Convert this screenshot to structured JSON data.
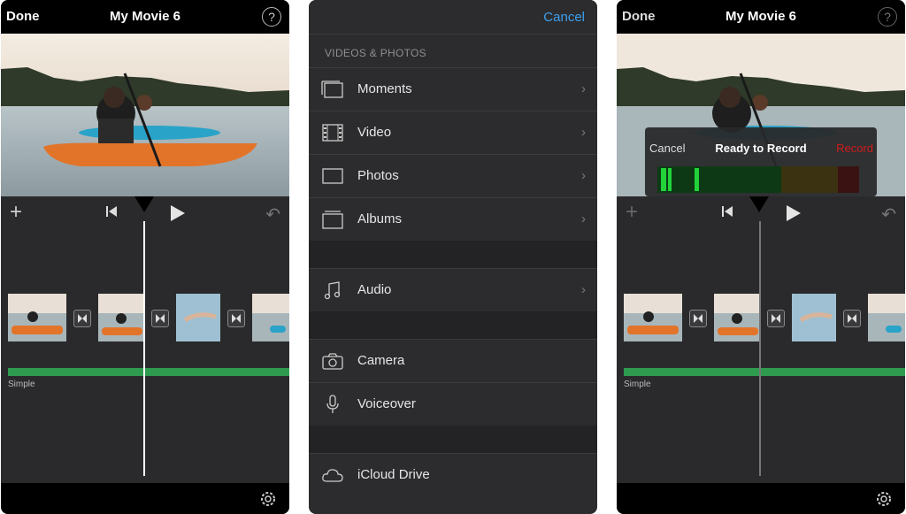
{
  "editor": {
    "done_label": "Done",
    "title": "My Movie 6",
    "help_icon": "?",
    "music_label": "Simple"
  },
  "picker": {
    "cancel_label": "Cancel",
    "section_header": "VIDEOS & PHOTOS",
    "items": [
      {
        "label": "Moments",
        "icon": "moments-icon",
        "chevron": "›"
      },
      {
        "label": "Video",
        "icon": "film-icon",
        "chevron": "›"
      },
      {
        "label": "Photos",
        "icon": "photo-icon",
        "chevron": "›"
      },
      {
        "label": "Albums",
        "icon": "albums-icon",
        "chevron": "›"
      },
      {
        "label": "Audio",
        "icon": "music-note-icon",
        "chevron": "›"
      },
      {
        "label": "Camera",
        "icon": "camera-icon"
      },
      {
        "label": "Voiceover",
        "icon": "microphone-icon"
      },
      {
        "label": "iCloud Drive",
        "icon": "cloud-icon"
      }
    ]
  },
  "record": {
    "cancel_label": "Cancel",
    "title": "Ready to Record",
    "record_label": "Record"
  },
  "colors": {
    "accent": "#3a9ff0",
    "record": "#d01b1b",
    "music_track": "#2e9b4f"
  }
}
